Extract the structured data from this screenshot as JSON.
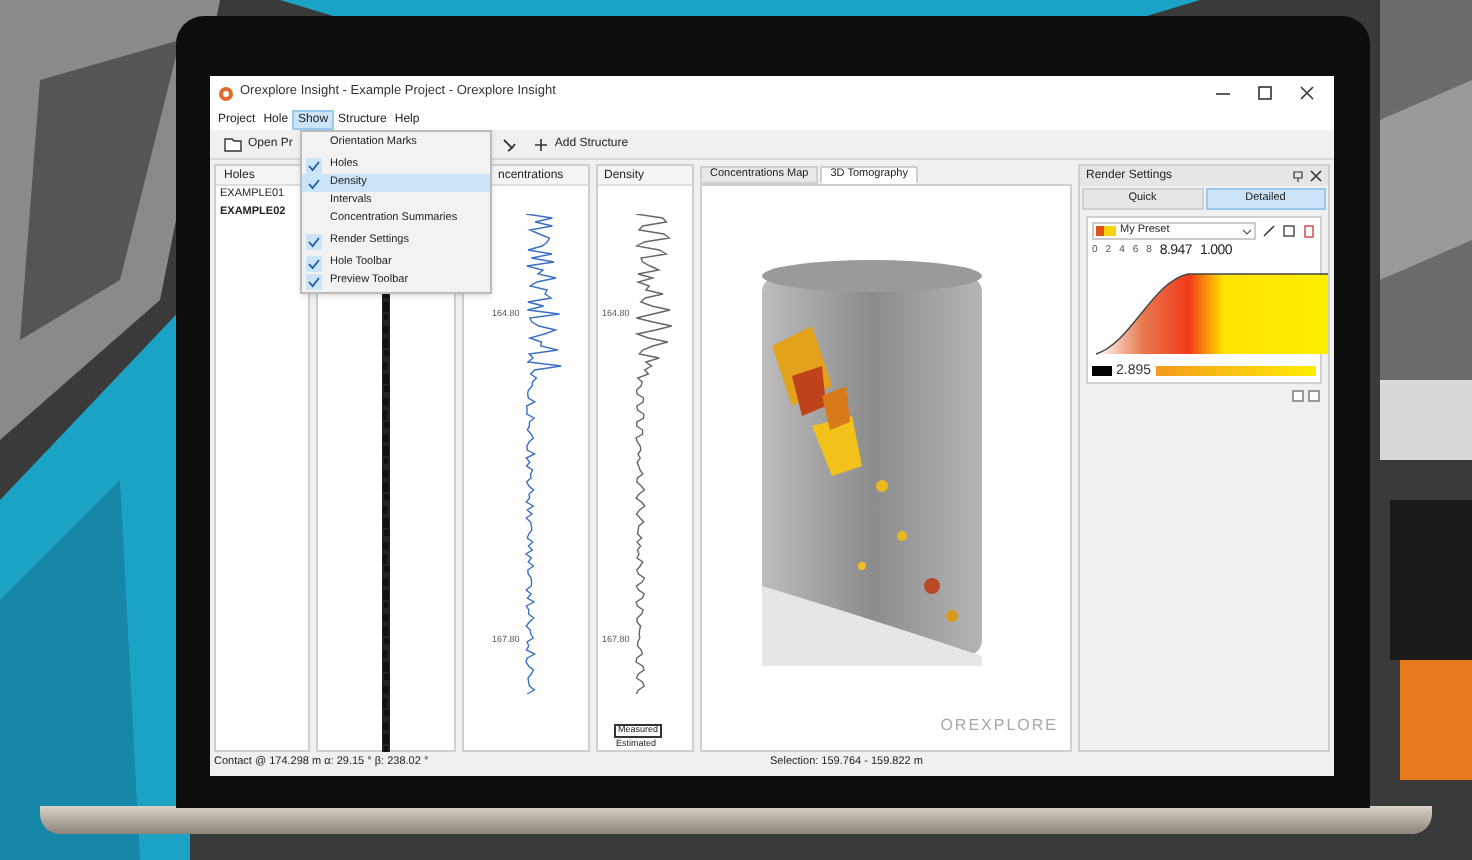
{
  "window": {
    "title": "Orexplore Insight - Example Project - Orexplore Insight"
  },
  "menu_bar": [
    {
      "label": "Project",
      "selected": false
    },
    {
      "label": "Hole",
      "selected": false
    },
    {
      "label": "Show",
      "selected": true
    },
    {
      "label": "Structure",
      "selected": false
    },
    {
      "label": "Help",
      "selected": false
    }
  ],
  "toolbar": {
    "open_button": "Open Pr",
    "add_button": "Add Structure"
  },
  "show_menu": [
    {
      "label": "Orientation Marks",
      "checked": false,
      "selected": false
    },
    {
      "label": "Holes",
      "checked": true,
      "selected": false
    },
    {
      "label": "Density",
      "checked": true,
      "selected": true
    },
    {
      "label": "Intervals",
      "checked": false,
      "selected": false
    },
    {
      "label": "Concentration Summaries",
      "checked": false,
      "selected": false
    },
    {
      "label": "Render Settings",
      "checked": true,
      "selected": false
    },
    {
      "label": "Hole Toolbar",
      "checked": true,
      "selected": false
    },
    {
      "label": "Preview Toolbar",
      "checked": true,
      "selected": false
    }
  ],
  "holes_panel": {
    "header": "Holes",
    "items": [
      {
        "label": "EXAMPLE01",
        "selected": false
      },
      {
        "label": "EXAMPLE02",
        "selected": true
      }
    ]
  },
  "concentrations_panel": {
    "header": "ncentrations",
    "depth_labels": [
      "164.80",
      "167.80"
    ]
  },
  "density_panel": {
    "header": "Density",
    "depth_labels": [
      "164.80",
      "167.80"
    ],
    "legend": [
      "Measured",
      "Estimated"
    ]
  },
  "viewer": {
    "tabs": [
      {
        "label": "Concentrations Map",
        "selected": false
      },
      {
        "label": "3D Tomography",
        "selected": true
      }
    ],
    "watermark": "OREXPLORE"
  },
  "render_settings": {
    "title": "Render Settings",
    "modes": [
      {
        "label": "Quick",
        "selected": false
      },
      {
        "label": "Detailed",
        "selected": true
      }
    ],
    "preset": "My Preset",
    "ticks": [
      "0",
      "2",
      "4",
      "6",
      "8"
    ],
    "max_value": "8.947",
    "max_opacity": "1.000",
    "min_value": "2.895"
  },
  "status_bar": {
    "left": "Contact @ 174.298 m α: 29.15 ° β: 238.02 °",
    "center": "Selection: 159.764 - 159.822 m"
  }
}
